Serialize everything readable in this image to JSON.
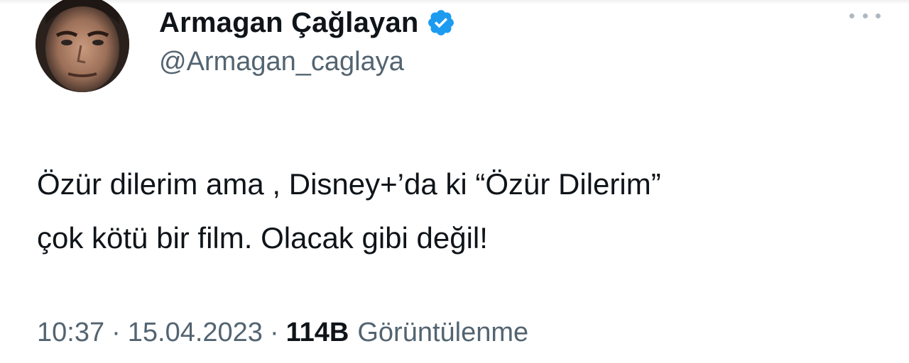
{
  "author": {
    "display_name": "Armagan Çağlayan",
    "handle": "@Armagan_caglaya",
    "verified": true,
    "verified_color": "#1d9bf0"
  },
  "tweet": {
    "lines": [
      "Özür dilerim ama , Disney+’da ki “Özür Dilerim”",
      "çok kötü bir film. Olacak gibi değil!"
    ]
  },
  "meta": {
    "time": "10:37",
    "separator": "·",
    "date": "15.04.2023",
    "views_count": "114B",
    "views_label": "Görüntülenme"
  },
  "icons": {
    "more": "more-horizontal-icon",
    "verified": "verified-badge-icon"
  },
  "colors": {
    "text_primary": "#0f1419",
    "text_secondary": "#536471"
  }
}
